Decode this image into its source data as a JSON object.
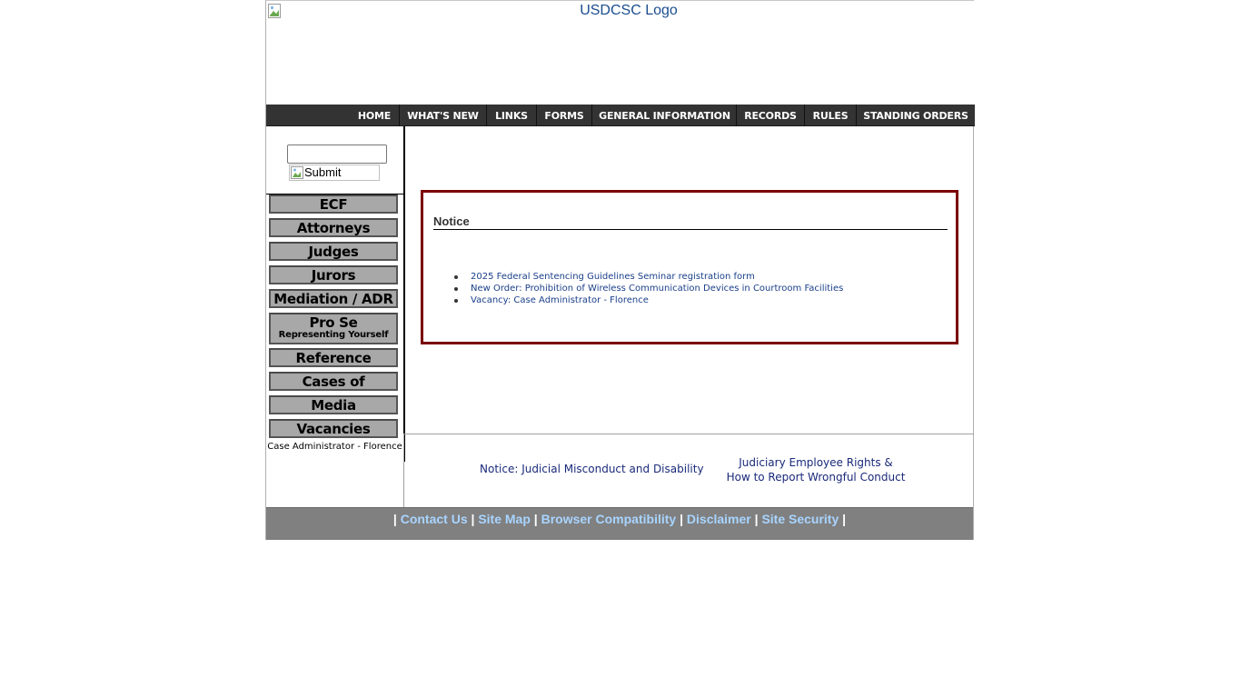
{
  "header": {
    "logo_alt": "USDCSC Logo"
  },
  "topnav": {
    "items": [
      {
        "label": "HOME"
      },
      {
        "label": "WHAT'S NEW"
      },
      {
        "label": "LINKS"
      },
      {
        "label": "FORMS"
      },
      {
        "label": "GENERAL INFORMATION"
      },
      {
        "label": "RECORDS"
      },
      {
        "label": "RULES"
      },
      {
        "label": "STANDING ORDERS"
      }
    ]
  },
  "search": {
    "value": "",
    "submit_alt": "Submit"
  },
  "sidebar": {
    "items": [
      {
        "label": "ECF"
      },
      {
        "label": "Attorneys"
      },
      {
        "label": "Judges"
      },
      {
        "label": "Jurors"
      },
      {
        "label": "Mediation / ADR"
      },
      {
        "label": "Pro Se",
        "sublabel": "Representing Yourself"
      },
      {
        "label": "Reference"
      },
      {
        "label": "Cases of Interest"
      },
      {
        "label": "Media"
      },
      {
        "label": "Vacancies"
      }
    ],
    "vacancy_link": "Case Administrator - Florence"
  },
  "notice": {
    "title": "Notice",
    "items": [
      {
        "text": "2025 Federal Sentencing Guidelines Seminar registration form"
      },
      {
        "text": "New Order: Prohibition of Wireless Communication Devices in Courtroom Facilities"
      },
      {
        "text": "Vacancy: Case Administrator - Florence"
      }
    ]
  },
  "footer_links": {
    "misconduct": "Notice: Judicial Misconduct and Disability",
    "rights_line1": "Judiciary Employee Rights &",
    "rights_line2": "How to Report Wrongful Conduct"
  },
  "bottombar": {
    "separator": "|",
    "links": [
      {
        "label": "Contact Us"
      },
      {
        "label": "Site Map"
      },
      {
        "label": "Browser Compatibility"
      },
      {
        "label": "Disclaimer"
      },
      {
        "label": "Site Security"
      }
    ]
  },
  "colors": {
    "nav_bg": "#333333",
    "notice_border": "#7a0000",
    "sidebar_button_bg": "#a8a8a8",
    "bottombar_bg": "#808080",
    "bottombar_link": "#a8d4ff",
    "link_blue": "#1a3f8a"
  }
}
